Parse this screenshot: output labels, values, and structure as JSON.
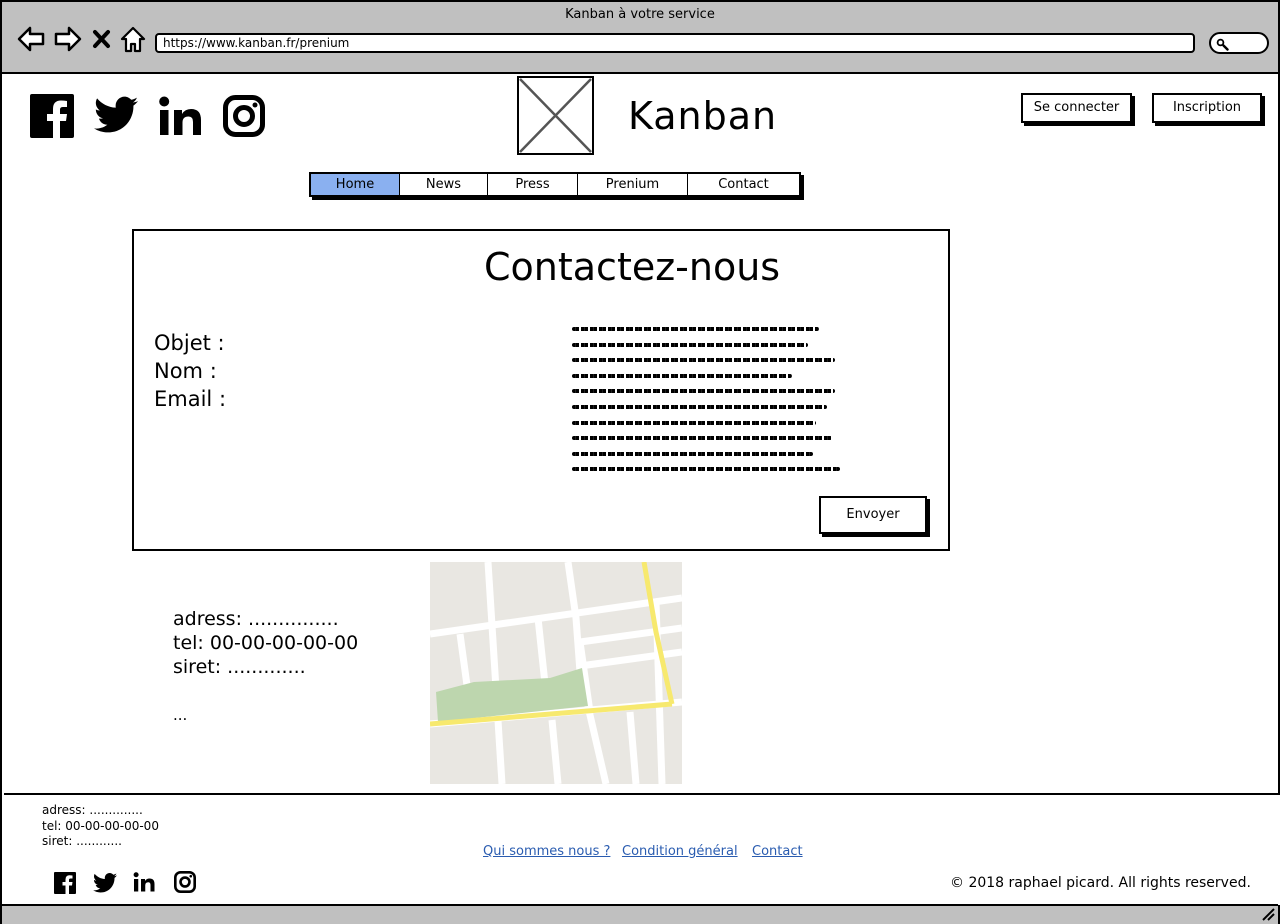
{
  "window": {
    "title": "Kanban à votre service",
    "url": "https://www.kanban.fr/prenium"
  },
  "browser_nav": {
    "icons": [
      "back-arrow-icon",
      "forward-arrow-icon",
      "close-icon",
      "home-icon",
      "search-icon"
    ]
  },
  "header": {
    "brand": "Kanban",
    "logo": "image-placeholder-icon",
    "social_icons": [
      "facebook-icon",
      "twitter-icon",
      "linkedin-icon",
      "instagram-icon"
    ],
    "login_label": "Se connecter",
    "signup_label": "Inscription"
  },
  "tabs": [
    {
      "label": "Home",
      "active": true
    },
    {
      "label": "News",
      "active": false
    },
    {
      "label": "Press",
      "active": false
    },
    {
      "label": "Prenium",
      "active": false
    },
    {
      "label": "Contact",
      "active": false
    }
  ],
  "colors": {
    "active_tab": "#8ab0f0",
    "chrome": "#c0c0c0",
    "link": "#2a5cb0",
    "map_road_yellow": "#f7e96e",
    "map_park_green": "#bdd6ae"
  },
  "contact": {
    "title": "Contactez-nous",
    "fields": [
      "Objet :",
      "Nom :",
      "Email :"
    ],
    "send_label": "Envoyer"
  },
  "info": {
    "adress": "adress: ...............",
    "tel": "tel: 00-00-00-00-00",
    "siret": "siret: .............",
    "more": "..."
  },
  "footer": {
    "adress": "adress: ..............",
    "tel": "tel: 00-00-00-00-00",
    "siret": "siret: ............",
    "links": [
      "Qui sommes nous ?",
      "Condition général",
      "Contact"
    ],
    "copyright": "© 2018 raphael picard. All rights reserved."
  }
}
